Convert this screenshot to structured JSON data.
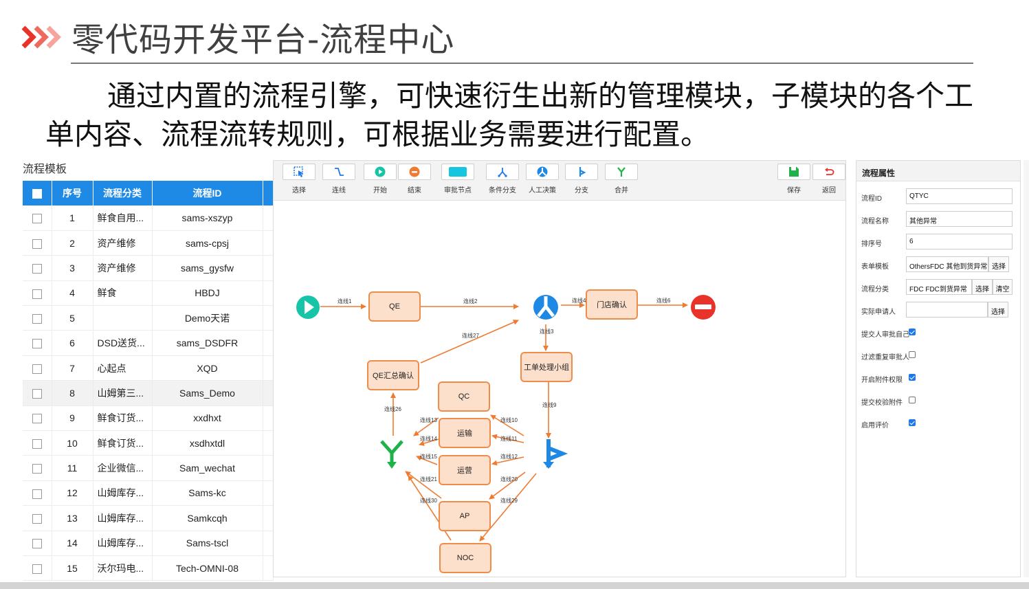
{
  "slide": {
    "title": "零代码开发平台-流程中心",
    "intro": "通过内置的流程引擎，可快速衍生出新的管理模块，子模块的各个工单内容、流程流转规则，可根据业务需要进行配置。"
  },
  "template_list": {
    "heading": "流程模板",
    "columns": [
      "序号",
      "流程分类",
      "流程ID"
    ],
    "rows": [
      {
        "no": "1",
        "category": "鲜食自用...",
        "id": "sams-xszyp"
      },
      {
        "no": "2",
        "category": "资产维修",
        "id": "sams-cpsj"
      },
      {
        "no": "3",
        "category": "资产维修",
        "id": "sams_gysfw"
      },
      {
        "no": "4",
        "category": "鲜食",
        "id": "HBDJ"
      },
      {
        "no": "5",
        "category": "",
        "id": "Demo天诺"
      },
      {
        "no": "6",
        "category": "DSD送货...",
        "id": "sams_DSDFR"
      },
      {
        "no": "7",
        "category": "心起点",
        "id": "XQD"
      },
      {
        "no": "8",
        "category": "山姆第三...",
        "id": "Sams_Demo"
      },
      {
        "no": "9",
        "category": "鲜食订货...",
        "id": "xxdhxt"
      },
      {
        "no": "10",
        "category": "鲜食订货...",
        "id": "xsdhxtdl"
      },
      {
        "no": "11",
        "category": "企业微信...",
        "id": "Sam_wechat"
      },
      {
        "no": "12",
        "category": "山姆库存...",
        "id": "Sams-kc"
      },
      {
        "no": "13",
        "category": "山姆库存...",
        "id": "Samkcqh"
      },
      {
        "no": "14",
        "category": "山姆库存...",
        "id": "Sams-tscl"
      },
      {
        "no": "15",
        "category": "沃尔玛电...",
        "id": "Tech-OMNI-08"
      }
    ]
  },
  "toolbar": {
    "tools": [
      {
        "label": "选择",
        "icon": "cursor-icon"
      },
      {
        "label": "连线",
        "icon": "connector-icon"
      },
      {
        "label": "开始",
        "icon": "start-icon"
      },
      {
        "label": "结束",
        "icon": "end-icon"
      },
      {
        "label": "审批节点",
        "icon": "approval-node-icon"
      },
      {
        "label": "条件分支",
        "icon": "condition-branch-icon"
      },
      {
        "label": "人工决策",
        "icon": "manual-decision-icon"
      },
      {
        "label": "分支",
        "icon": "fork-icon"
      },
      {
        "label": "合并",
        "icon": "merge-icon"
      }
    ],
    "save_label": "保存",
    "back_label": "返回"
  },
  "flow": {
    "nodes": {
      "qe": "QE",
      "store_confirm": "门店确认",
      "qe_summary": "QE汇总确认",
      "ticket_team": "工单处理小组",
      "qc": "QC",
      "transport": "运输",
      "operation": "运营",
      "ap": "AP",
      "noc": "NOC"
    },
    "edges": {
      "l1": "连线1",
      "l2": "连线2",
      "l3": "连线3",
      "l4": "连线4",
      "l6": "连线6",
      "l9": "连线9",
      "l10": "连线10",
      "l11": "连线11",
      "l12": "连线12",
      "l13": "连线13",
      "l14": "连线14",
      "l15": "连线15",
      "l20": "连线20",
      "l21": "连线21",
      "l26": "连线26",
      "l27": "连线27",
      "l29": "连线29",
      "l30": "连线30"
    },
    "colors": {
      "node_fill": "#fde0cc",
      "node_border": "#f08c4a",
      "edge": "#f07a30",
      "start": "#18c4a8",
      "end": "#e8332a",
      "decision": "#1e88e5",
      "merge": "#20b24a"
    }
  },
  "properties": {
    "heading": "流程属性",
    "flow_id_label": "流程ID",
    "flow_id": "QTYC",
    "flow_name_label": "流程名称",
    "flow_name": "其他异常",
    "sort_label": "排序号",
    "sort": "6",
    "form_label": "表单模板",
    "form": "OthersFDC 其他到货异常",
    "form_select": "选择",
    "category_label": "流程分类",
    "category": "FDC FDC到货异常",
    "category_select": "选择",
    "category_clear": "清空",
    "applicant_label": "实际申请人",
    "applicant": "",
    "applicant_select": "选择",
    "self_approve_label": "提交人审批自己",
    "self_approve": true,
    "filter_dup_label": "过滤重复审批人",
    "filter_dup": false,
    "attach_perm_label": "开启附件权限",
    "attach_perm": true,
    "attach_check_label": "提交校验附件",
    "attach_check": false,
    "rating_label": "启用评价",
    "rating": true
  }
}
